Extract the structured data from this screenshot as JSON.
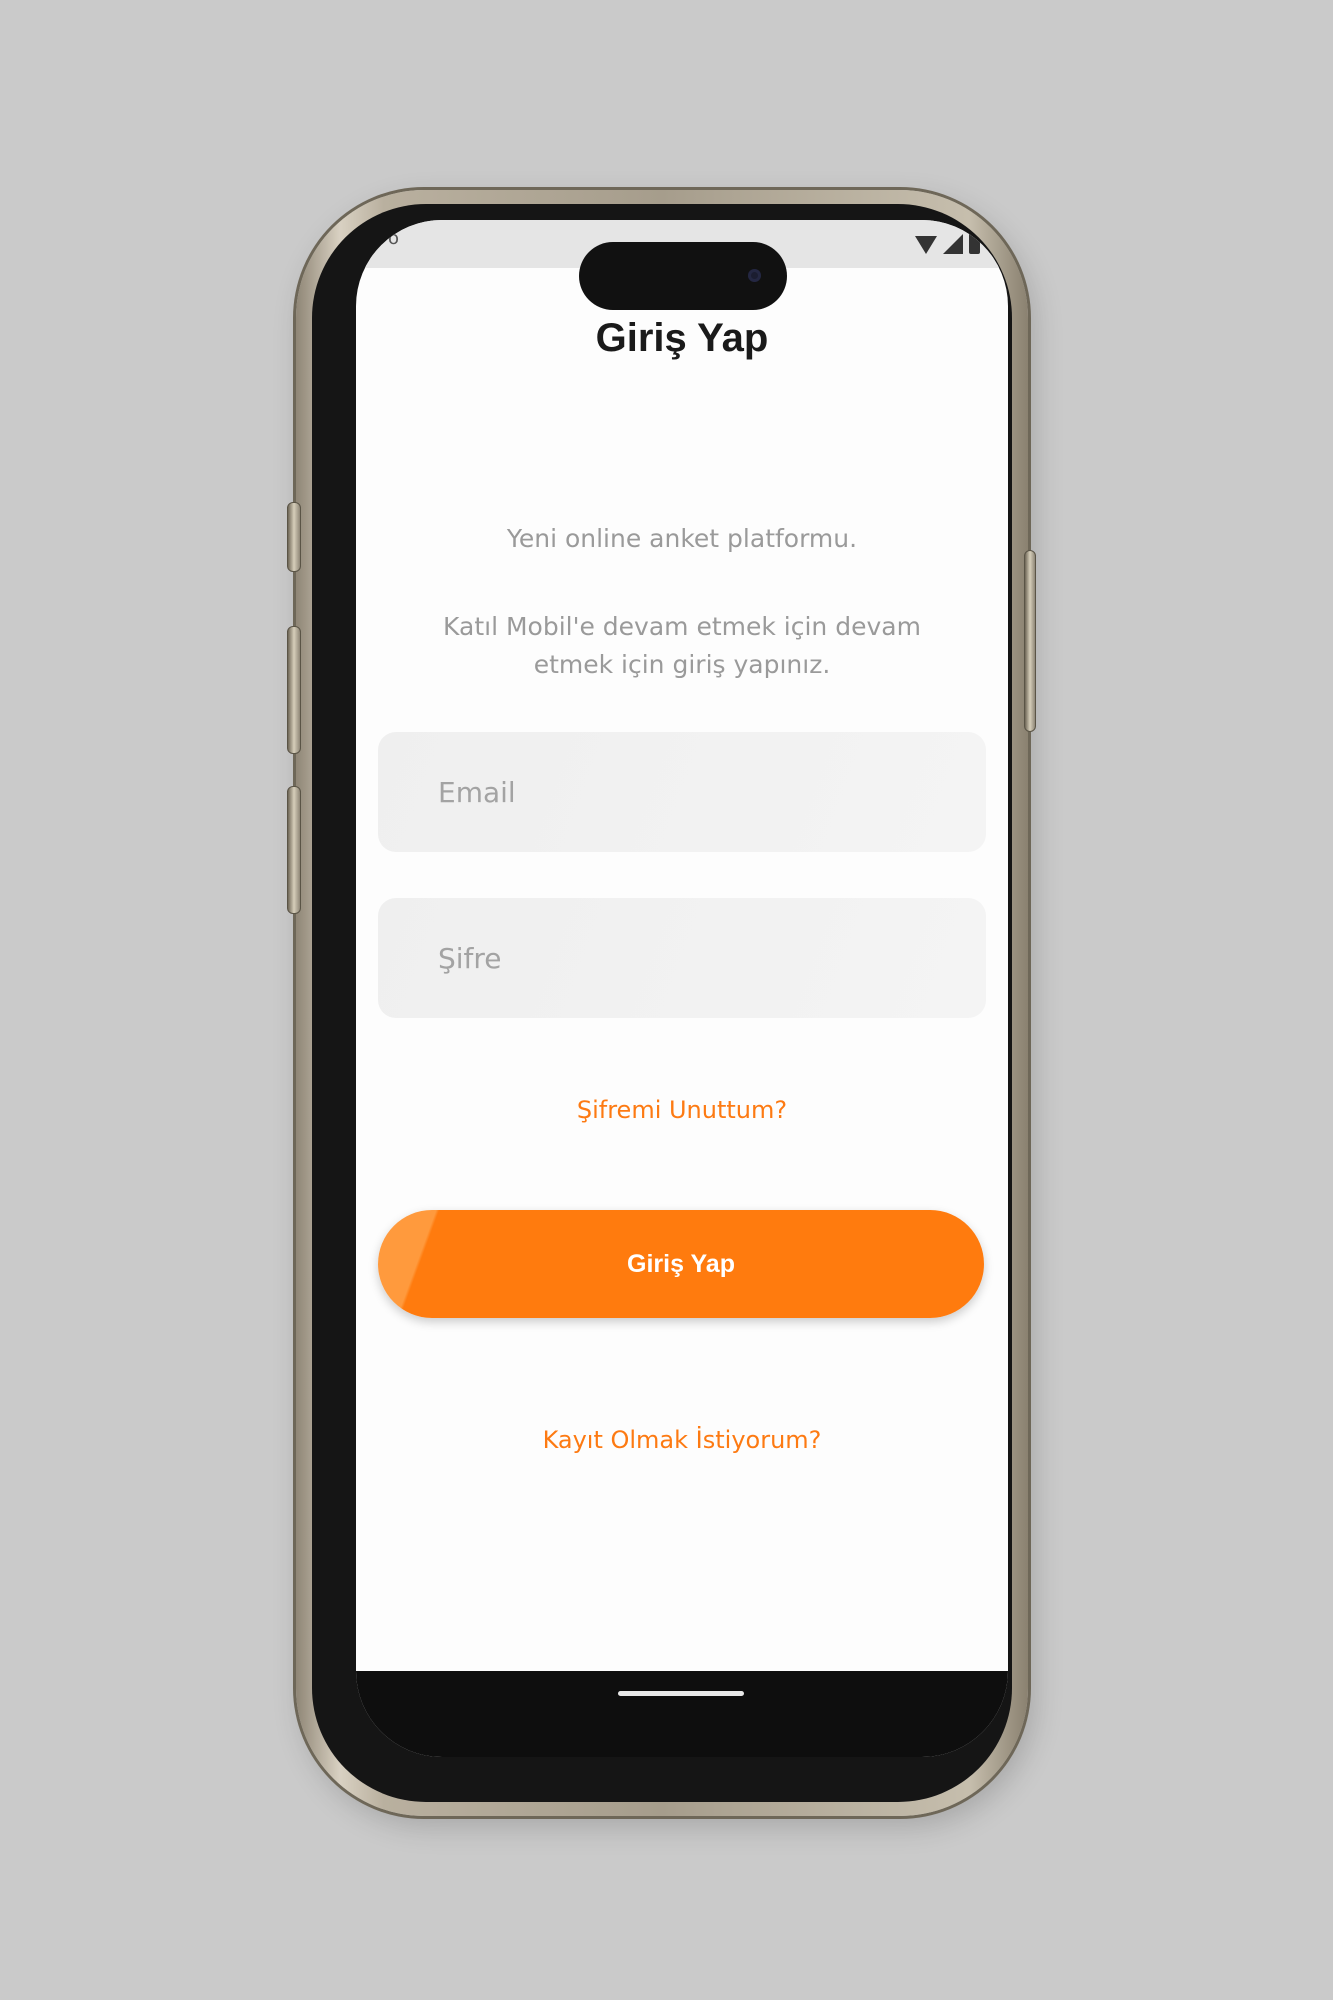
{
  "status_bar": {
    "left_text": "o"
  },
  "login": {
    "title": "Giriş Yap",
    "tagline": "Yeni online anket platformu.",
    "instruction": "Katıl Mobil'e devam etmek için devam etmek için giriş yapınız.",
    "email_placeholder": "Email",
    "password_placeholder": "Şifre",
    "forgot_password": "Şifremi Unuttum?",
    "submit_label": "Giriş Yap",
    "register_link": "Kayıt Olmak İstiyorum?"
  },
  "colors": {
    "accent": "#FF7B0E",
    "background": "#CACACA",
    "screen": "#FDFDFD",
    "muted_text": "#9A9A9A",
    "field_background": "#F1F1F1"
  },
  "icons": [
    "wifi-icon",
    "signal-icon",
    "battery-icon",
    "camera-icon"
  ]
}
